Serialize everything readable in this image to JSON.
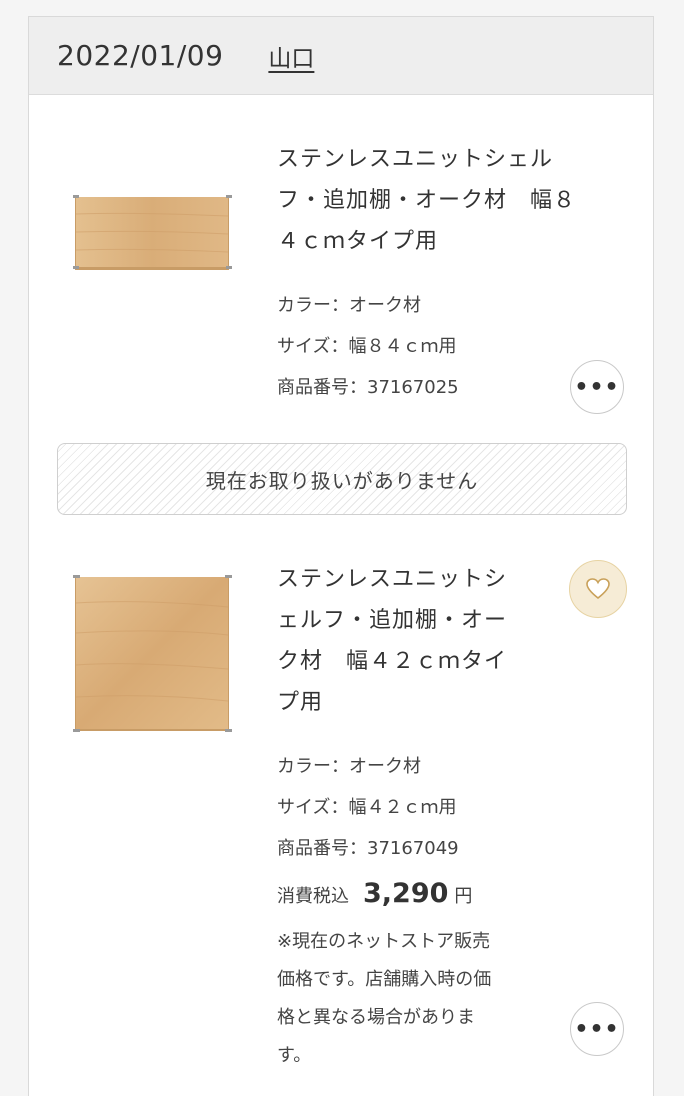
{
  "header": {
    "date": "2022/01/09",
    "store": "山口"
  },
  "items": [
    {
      "title_lines": [
        "ステンレスユニットシェル",
        "フ・追加棚・オーク材　幅８",
        "４ｃｍタイプ用"
      ],
      "color": "カラー：オーク材",
      "size": "サイズ：幅８４ｃｍ用",
      "product_no": "商品番号：37167025",
      "more_icon": "more-horizontal-icon"
    },
    {
      "title_lines": [
        "ステンレスユニットシ",
        "ェルフ・追加棚・オー",
        "ク材　幅４２ｃｍタイ",
        "プ用"
      ],
      "color": "カラー：オーク材",
      "size": "サイズ：幅４２ｃｍ用",
      "product_no": "商品番号：37167049",
      "price_label": "消費税込",
      "price": "3,290",
      "currency": "円",
      "note_lines": [
        "※現在のネットストア販売",
        "価格です。店舗購入時の価",
        "格と異なる場合がありま",
        "す。"
      ],
      "favorite_icon": "heart-icon",
      "more_icon": "more-horizontal-icon"
    }
  ],
  "unavailable_text": "現在お取り扱いがありません",
  "colors": {
    "header_bg": "#eeeeee",
    "favorite_bg": "#f6ecd6",
    "favorite_border": "#e7d3a3",
    "wood": "#d9b07e"
  }
}
